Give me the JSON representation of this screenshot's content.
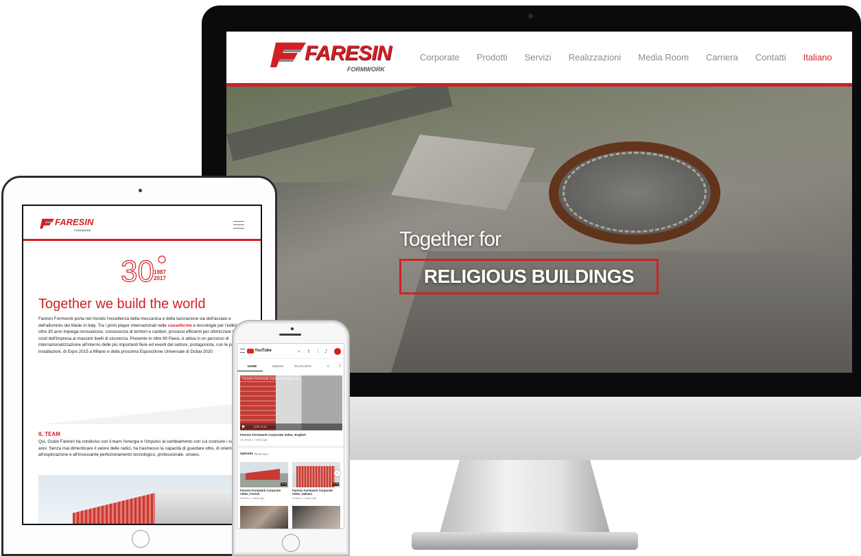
{
  "desktop": {
    "logo": {
      "word": "FARESIN",
      "sub": "FORMWORK"
    },
    "nav": [
      "Corporate",
      "Prodotti",
      "Servizi",
      "Realizzazioni",
      "Media Room",
      "Carriera",
      "Contatti",
      "Italiano"
    ],
    "active_nav": "Italiano",
    "hero": {
      "line1": "Together for",
      "line2": "RELIGIOUS BUILDINGS"
    }
  },
  "tablet": {
    "logo": {
      "word": "FARESIN",
      "sub": "FORMWORK"
    },
    "anniversary": {
      "number": "30",
      "years_from": "1987",
      "years_to": "2017"
    },
    "title": "Together we build the world",
    "body_before": "Faresin Formwork porta nel mondo l'eccellenza della meccanica e della lavorazione sia dell'acciaio e dell'alluminio del Made in Italy. Tra i primi player internazionali nelle ",
    "body_highlight": "casseforme",
    "body_after": " e tecnologie per l'edilizia, da oltre 30 anni impiega innovazione, conoscenza di territori e cantieri, processi efficienti per ottimizzare tempi e costi dell'impresa ai massimi livelli di sicurezza. Presente in oltre 80 Paesi, è attiva in un percorso di internazionalizzazione all'interno delle più importanti fiere ed eventi del settore; protagonista, con le proprie installazioni, di Expo 2015 a Milano e della prossima Esposizione Universale di Dubai 2020.",
    "team_heading": "IL TEAM",
    "team_body": "Qui, Guido Faresin ha condiviso con il team l'energia e l'impulso al cambiamento con cui costruire i successi negli anni. Senza mai dimenticare il valore delle radici, ha trasmesso la capacità di guardare oltre, di orientarsi all'esplorazione e all'incessante perfezionamento tecnologico, professionale, umano."
  },
  "phone": {
    "youtube_logo": "YouTube",
    "tabs": [
      "HOME",
      "VIDEOS",
      "PLAYLISTS",
      "C"
    ],
    "active_tab": "HOME",
    "featured": {
      "overlay_title": "Faresin Formwork Corporate Video_En...",
      "time": "2:09 / 5:14",
      "title": "Faresin Formwork Corporate Video_English",
      "meta": "12 views • 1 week ago"
    },
    "uploads_label": "Uploads",
    "play_all_label": "PLAY ALL",
    "uploads": [
      {
        "title": "Faresin Formwork Corporate Video_French",
        "meta": "8 views • 1 week ago",
        "duration": "5:14"
      },
      {
        "title": "Faresin Formwork Corporate Video_Italiano",
        "meta": "8 views • 1 week ago",
        "duration": "5:14"
      }
    ],
    "colors": {
      "brand_red": "#d21f26",
      "youtube_red": "#e62117"
    }
  }
}
